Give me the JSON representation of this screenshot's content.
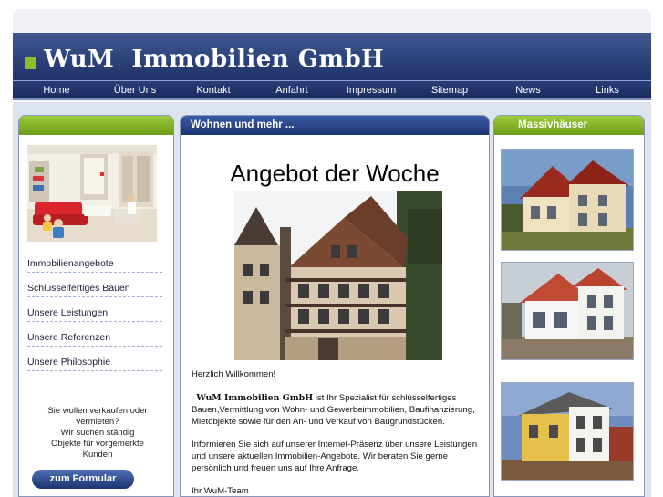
{
  "site": {
    "title": "WuM  Immobilien GmbH"
  },
  "nav": {
    "items": [
      "Home",
      "Über Uns",
      "Kontakt",
      "Anfahrt",
      "Impressum",
      "Sitemap",
      "News",
      "Links"
    ]
  },
  "sidebar": {
    "links": [
      "Immobilienangebote",
      "Schlüsselfertiges Bauen",
      "Unsere Leistungen",
      "Unsere Referenzen",
      "Unsere Philosophie"
    ],
    "sell_lines": [
      "Sie wollen verkaufen oder",
      "vermieten?",
      "Wir suchen ständig",
      "Objekte für vorgemerkte",
      "Kunden"
    ],
    "form_button": "zum Formular"
  },
  "main": {
    "header": "Wohnen und mehr ...",
    "offer_title": "Angebot der Woche",
    "welcome": "Herzlich Willkommen!",
    "brand": "WuM Immobilien GmbH",
    "intro": " ist Ihr Spezialist für schlüsselfertiges Bauen,Vermittlung von Wohn- und Gewerbeimmobilien, Baufinanzierung, Mietobjekte sowie für den An- und Verkauf von Baugrundstücken.",
    "info": "Informieren Sie sich auf unserer Internet-Präsenz über unsere Leistungen und unsere aktuellen Immobilien-Angebote. Wir beraten Sie gerne persönlich und freuen uns auf Ihre Anfrage.",
    "signature": "Ihr WuM-Team"
  },
  "right": {
    "header": "Massivhäuser"
  },
  "colors": {
    "header_blue": "#1d3369",
    "accent_green": "#8cbf2a"
  }
}
